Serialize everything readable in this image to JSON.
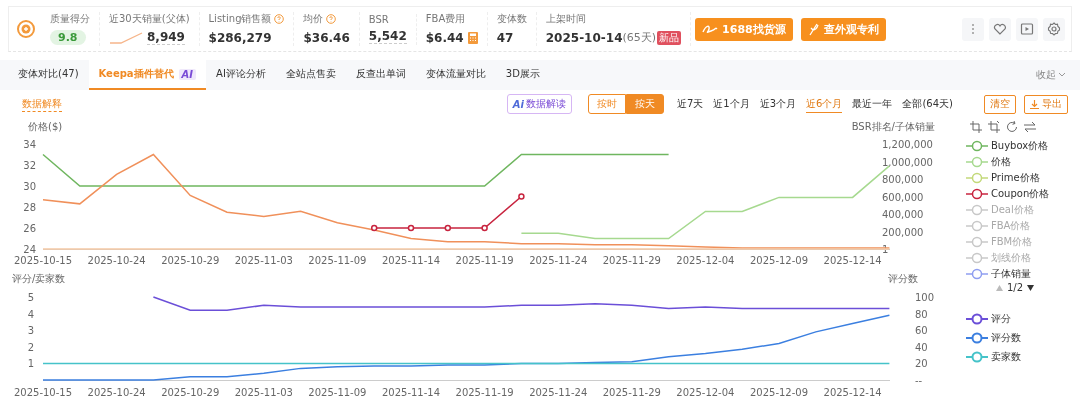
{
  "header": {
    "stats": [
      {
        "kind": "score",
        "label": "质量得分",
        "value": "9.8"
      },
      {
        "kind": "sparkline",
        "label": "近30天销量(父体)",
        "value": "8,949"
      },
      {
        "kind": "help",
        "label": "Listing销售额",
        "value": "$286,279"
      },
      {
        "kind": "help",
        "label": "均价",
        "value": "$36.46"
      },
      {
        "kind": "dashed",
        "label": "BSR",
        "value": "5,542"
      },
      {
        "kind": "calc",
        "label": "FBA费用",
        "value": "$6.44"
      },
      {
        "kind": "plain",
        "label": "变体数",
        "value": "47"
      },
      {
        "kind": "date",
        "label": "上架时间",
        "value": "2025-10-14",
        "days": "(65天)",
        "badge": "新品"
      }
    ],
    "buttons": [
      {
        "kind": "source",
        "label": "1688找货源"
      },
      {
        "kind": "patent",
        "label": "查外观专利"
      }
    ]
  },
  "tabs": [
    {
      "label": "变体对比(47)",
      "selected": false
    },
    {
      "label": "Keepa插件替代",
      "badge": "AI",
      "selected": true
    },
    {
      "label": "AI评论分析",
      "selected": false
    },
    {
      "label": "全站点售卖",
      "selected": false
    },
    {
      "label": "反查出单词",
      "selected": false
    },
    {
      "label": "变体流量对比",
      "selected": false
    },
    {
      "label": "3D展示",
      "selected": false
    }
  ],
  "collapse": "收起",
  "toolbar": {
    "explain": "数据解释",
    "ai_mark": "Ai",
    "ai_label": "数据解读",
    "modes": [
      {
        "label": "按时",
        "selected": false
      },
      {
        "label": "按天",
        "selected": true
      }
    ],
    "ranges": [
      {
        "label": "近7天",
        "selected": false
      },
      {
        "label": "近1个月",
        "selected": false
      },
      {
        "label": "近3个月",
        "selected": false
      },
      {
        "label": "近6个月",
        "selected": true
      },
      {
        "label": "最近一年",
        "selected": false
      },
      {
        "label": "全部(64天)",
        "selected": false
      }
    ],
    "clear": "清空",
    "export": "导出"
  },
  "price_chart": {
    "chart_data": {
      "type": "line",
      "ylabel": "价格($)",
      "y2label": "BSR排名/子体销量",
      "categories": [
        "2025-10-15",
        null,
        "2025-10-24",
        null,
        "2025-10-29",
        null,
        "2025-11-03",
        null,
        "2025-11-09",
        null,
        "2025-11-14",
        null,
        "2025-11-19",
        null,
        "2025-11-24",
        null,
        "2025-11-29",
        null,
        "2025-12-04",
        null,
        "2025-12-09",
        null,
        "2025-12-14",
        null
      ],
      "ylim": [
        24,
        34
      ],
      "y2lim": [
        1,
        1200000
      ],
      "yticks": [
        24,
        26,
        28,
        30,
        32,
        34
      ],
      "y2ticks": [
        {
          "value": 1,
          "label": "1"
        },
        {
          "value": 200000,
          "label": "200,000"
        },
        {
          "value": 400000,
          "label": "400,000"
        },
        {
          "value": 600000,
          "label": "600,000"
        },
        {
          "value": 800000,
          "label": "800,000"
        },
        {
          "value": 1000000,
          "label": "1,000,000"
        },
        {
          "value": 1200000,
          "label": "1,200,000"
        }
      ],
      "series": [
        {
          "color": "#6fb65f",
          "values": [
            33,
            30,
            30,
            30,
            30,
            30,
            30,
            30,
            30,
            30,
            30,
            30,
            30,
            33,
            33,
            33,
            33,
            33,
            null,
            null,
            null,
            null,
            null,
            null
          ]
        },
        {
          "color": "#a6d98f",
          "axis": "y2",
          "values": [
            null,
            null,
            null,
            null,
            null,
            null,
            null,
            null,
            null,
            null,
            null,
            null,
            null,
            180000,
            180000,
            120000,
            120000,
            120000,
            430000,
            430000,
            590000,
            590000,
            590000,
            950000
          ]
        },
        {
          "color": "#f0905a",
          "values": [
            28.7,
            28.3,
            31.1,
            33,
            29.1,
            27.5,
            27.1,
            27.6,
            26.5,
            25.8,
            25,
            24.7,
            24.7,
            24.5,
            24.5,
            24.4,
            24.4,
            24.3,
            24.2,
            24.1,
            24.1,
            24.1,
            24.1,
            24.1
          ]
        },
        {
          "color": "#f5c9a5",
          "axis": "y2",
          "values": [
            1,
            1,
            1,
            1,
            1,
            1,
            1,
            1,
            1,
            1,
            1,
            1,
            1,
            1,
            1,
            1,
            1,
            1,
            1,
            1,
            1,
            1,
            1,
            1
          ]
        },
        {
          "color": "#c8243f",
          "marker": "circle",
          "values": [
            null,
            null,
            null,
            null,
            null,
            null,
            null,
            null,
            null,
            26,
            26,
            26,
            26,
            29,
            null,
            null,
            null,
            null,
            null,
            null,
            null,
            null,
            null,
            null
          ]
        }
      ]
    }
  },
  "rating_chart": {
    "chart_data": {
      "type": "line",
      "ylabel": "评分/卖家数",
      "y2label": "评分数",
      "categories": [
        "2025-10-15",
        null,
        "2025-10-24",
        null,
        "2025-10-29",
        null,
        "2025-11-03",
        null,
        "2025-11-09",
        null,
        "2025-11-14",
        null,
        "2025-11-19",
        null,
        "2025-11-24",
        null,
        "2025-11-29",
        null,
        "2025-12-04",
        null,
        "2025-12-09",
        null,
        "2025-12-14",
        null
      ],
      "ylim": [
        0,
        5
      ],
      "y2lim": [
        0,
        100
      ],
      "yticks": [
        1,
        2,
        3,
        4,
        5
      ],
      "y2ticks": [
        {
          "value": 0,
          "label": "--"
        },
        {
          "value": 20,
          "label": "20"
        },
        {
          "value": 40,
          "label": "40"
        },
        {
          "value": 60,
          "label": "60"
        },
        {
          "value": 80,
          "label": "80"
        },
        {
          "value": 100,
          "label": "100"
        }
      ],
      "series": [
        {
          "color": "#6b4fd8",
          "values": [
            null,
            null,
            null,
            5,
            4.2,
            4.2,
            4.5,
            4.4,
            4.4,
            4.4,
            4.4,
            4.4,
            4.4,
            4.5,
            4.5,
            4.6,
            4.5,
            4.3,
            4.4,
            4.3,
            4.3,
            4.3,
            4.3,
            4.3
          ]
        },
        {
          "color": "#3b7fe0",
          "axis": "y2",
          "values": [
            0,
            0,
            0,
            0,
            4,
            4,
            8,
            14,
            16,
            17,
            17,
            18,
            18,
            20,
            20,
            21,
            22,
            28,
            32,
            37,
            44,
            58,
            68,
            78
          ]
        },
        {
          "color": "#45c3c9",
          "values": [
            1,
            1,
            1,
            1,
            1,
            1,
            1,
            1,
            1,
            1,
            1,
            1,
            1,
            1,
            1,
            1,
            1,
            1,
            1,
            1,
            1,
            1,
            1,
            1
          ]
        }
      ]
    }
  },
  "legend_top": {
    "items": [
      {
        "label": "Buybox价格",
        "color": "#6fb65f",
        "disabled": false
      },
      {
        "label": "价格",
        "color": "#a6d98f",
        "disabled": false
      },
      {
        "label": "Prime价格",
        "color": "#c3d97a",
        "disabled": false
      },
      {
        "label": "Coupon价格",
        "color": "#c8243f",
        "disabled": false
      },
      {
        "label": "Deal价格",
        "disabled": true
      },
      {
        "label": "FBA价格",
        "disabled": true
      },
      {
        "label": "FBM价格",
        "disabled": true
      },
      {
        "label": "划线价格",
        "disabled": true
      },
      {
        "label": "子体销量",
        "color": "#8f9ef0",
        "disabled": false
      }
    ],
    "pager": "1/2"
  },
  "legend_bottom": {
    "items": [
      {
        "label": "评分",
        "color": "#6b4fd8",
        "disabled": false
      },
      {
        "label": "评分数",
        "color": "#3b7fe0",
        "disabled": false
      },
      {
        "label": "卖家数",
        "color": "#45c3c9",
        "disabled": false
      }
    ]
  }
}
